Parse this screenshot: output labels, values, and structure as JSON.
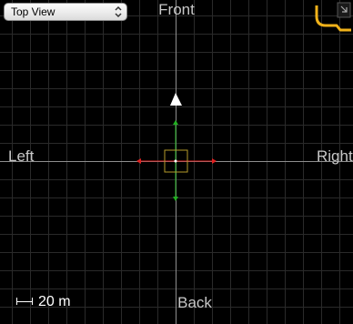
{
  "viewport": {
    "view_select": {
      "value": "Top View"
    },
    "labels": {
      "front": "Front",
      "back": "Back",
      "left": "Left",
      "right": "Right"
    },
    "scale": {
      "value": "20 m"
    },
    "colors": {
      "grid": "#2a2a2a",
      "axis": "#8e8e8e",
      "x_gizmo": "#e02020",
      "y_gizmo": "#20b020",
      "object_box": "#b59a2a",
      "corner_button": "#f0b21a"
    },
    "icons": {
      "select_chevron": "chevron-up-down-icon",
      "corner_button": "corner-bracket-icon",
      "camera_direction": "up-triangle-icon"
    }
  }
}
